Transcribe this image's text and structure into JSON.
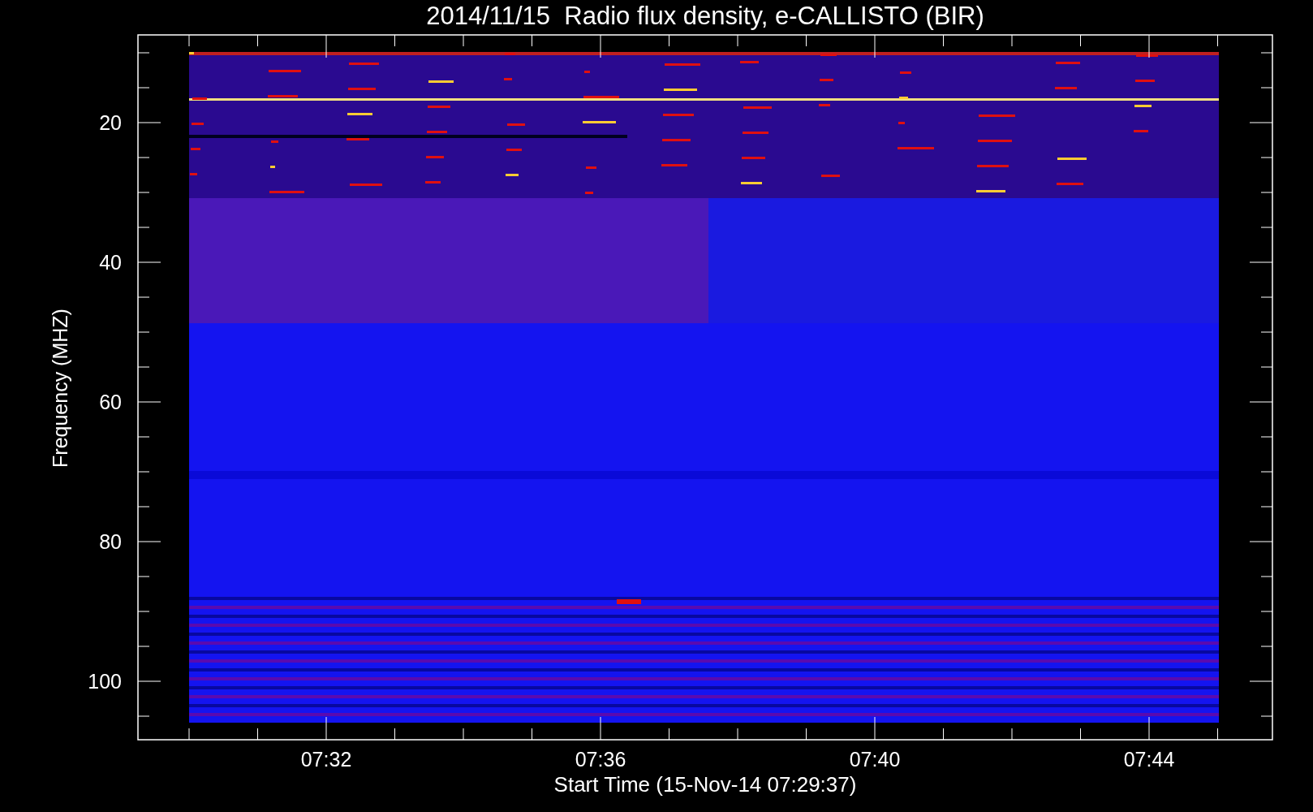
{
  "title": "2014/11/15  Radio flux density, e-CALLISTO (BIR)",
  "y_axis": {
    "label": "Frequency (MHZ)",
    "ticks": [
      "20",
      "40",
      "60",
      "80",
      "100"
    ]
  },
  "x_axis": {
    "label": "Start Time (15-Nov-14 07:29:37)",
    "ticks": [
      "07:32",
      "07:36",
      "07:40",
      "07:44"
    ]
  }
}
